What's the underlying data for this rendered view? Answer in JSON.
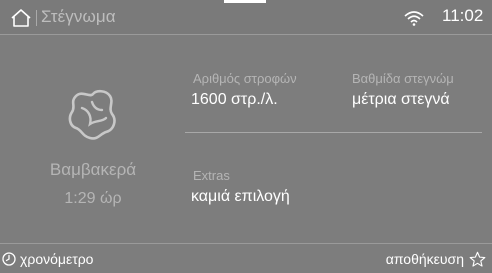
{
  "header": {
    "home_icon": "home-icon",
    "title": "Στέγνωμα",
    "wifi_icon": "wifi-icon",
    "clock": "11:02"
  },
  "program": {
    "icon": "cotton-icon",
    "name": "Βαμβακερά",
    "time": "1:29  ώρ"
  },
  "settings": {
    "spin": {
      "label": "Αριθμός στροφών",
      "value": "1600 στρ./λ."
    },
    "dryness": {
      "label": "Βαθμίδα στεγνώμ",
      "value": "μέτρια στεγνά"
    },
    "extras": {
      "label": "Extras",
      "value": "καμιά επιλογή"
    }
  },
  "footer": {
    "timer_icon": "clock-icon",
    "timer_label": "χρονόμετρο",
    "save_label": "αποθήκευση",
    "save_icon": "star-outline-icon"
  },
  "colors": {
    "background": "#7d7d7d",
    "muted_text": "#b5b5b5",
    "text": "#ffffff"
  }
}
